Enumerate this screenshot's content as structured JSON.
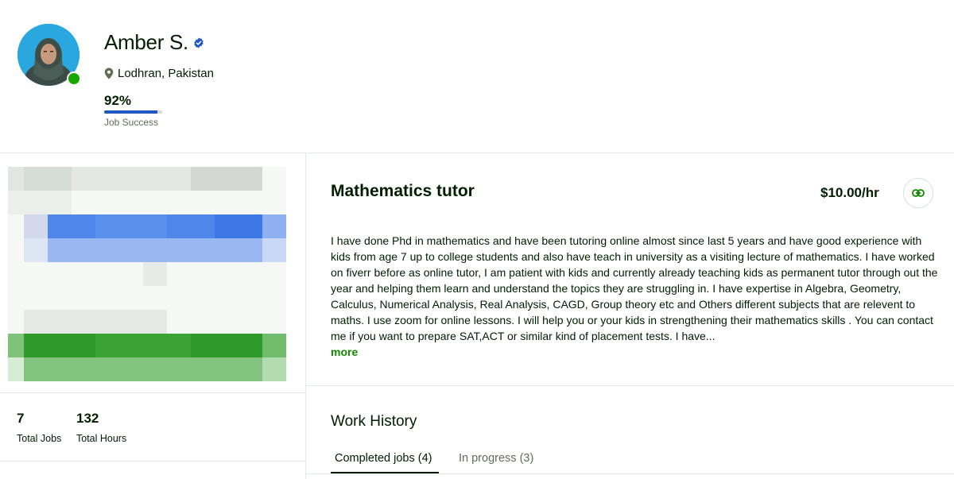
{
  "profile": {
    "name": "Amber S.",
    "location": "Lodhran, Pakistan",
    "job_success_pct": "92%",
    "job_success_value": 0.92,
    "job_success_label": "Job Success"
  },
  "stats": {
    "total_jobs": "7",
    "total_jobs_label": "Total Jobs",
    "total_hours": "132",
    "total_hours_label": "Total Hours"
  },
  "job": {
    "title": "Mathematics tutor",
    "rate": "$10.00/hr",
    "description": "I have done Phd in mathematics and have been tutoring online almost since last 5 years and have good experience with kids from age 7 up to college students and also have teach in university as a visiting lecture of mathematics. I have worked on fiverr before as online tutor, I am patient with kids and currently already teaching kids as permanent tutor through out the year and helping them learn and understand the topics they are struggling in. I have expertise in Algebra, Geometry, Calculus, Numerical Analysis, Real Analysis, CAGD, Group theory etc and Others different subjects that are relevent to maths. I use zoom for online lessons. I will help you or your kids in strengthening their mathematics skills . You can contact me if you want to prepare SAT,ACT or similar kind of placement tests. I have...",
    "more_label": "more"
  },
  "work_history": {
    "title": "Work History",
    "tabs": [
      {
        "label": "Completed jobs (4)"
      },
      {
        "label": "In progress (3)"
      }
    ]
  },
  "colors": {
    "brand_green": "#108a00",
    "online_green": "#14a800",
    "verified_blue": "#1f57c3",
    "text": "#001e00"
  },
  "icons": {
    "verified": "verified-badge-icon",
    "location": "location-pin-icon",
    "link": "link-icon"
  }
}
